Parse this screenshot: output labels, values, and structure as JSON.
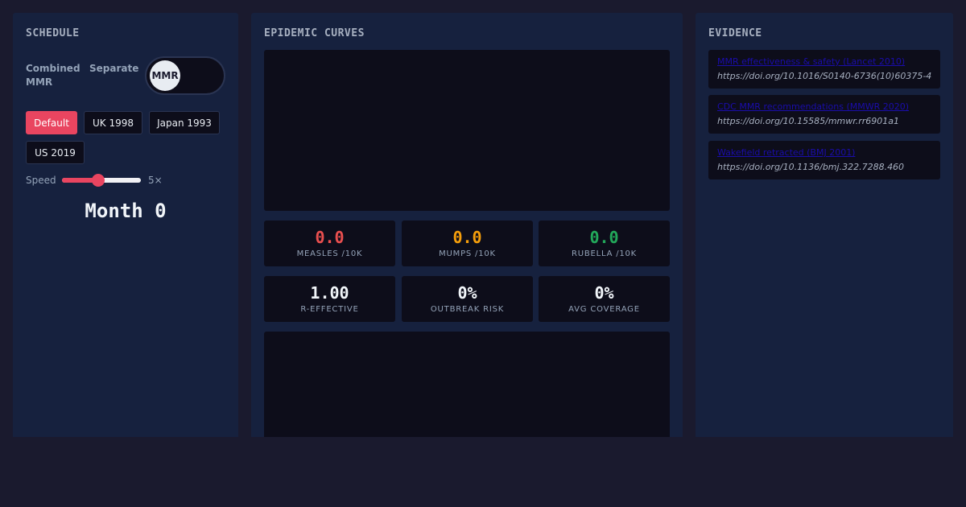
{
  "schedule": {
    "title": "SCHEDULE",
    "combined_label": "Combined MMR",
    "separate_label": "Separate",
    "toggle_label": "MMR",
    "presets": [
      "Default",
      "UK 1998",
      "Japan 1993",
      "US 2019"
    ],
    "active_preset": "Default",
    "speed_label": "Speed",
    "speed_value": "5×",
    "speed_level_fraction": 0.45,
    "month_label": "Month 0"
  },
  "epi": {
    "title": "EPIDEMIC CURVES",
    "stats_row1": [
      {
        "value": "0.0",
        "label": "MEASLES /10K",
        "color": "#e94f4f"
      },
      {
        "value": "0.0",
        "label": "MUMPS /10K",
        "color": "#f59e0b"
      },
      {
        "value": "0.0",
        "label": "RUBELLA /10K",
        "color": "#22a85a"
      }
    ],
    "stats_row2": [
      {
        "value": "1.00",
        "label": "R-EFFECTIVE"
      },
      {
        "value": "0%",
        "label": "OUTBREAK RISK"
      },
      {
        "value": "0%",
        "label": "AVG COVERAGE"
      }
    ]
  },
  "evidence": {
    "title": "EVIDENCE",
    "items": [
      {
        "title": "MMR effectiveness & safety (Lancet 2010)",
        "doi": "https://doi.org/10.1016/S0140-6736(10)60375-4"
      },
      {
        "title": "CDC MMR recommendations (MMWR 2020)",
        "doi": "https://doi.org/10.15585/mmwr.rr6901a1"
      },
      {
        "title": "Wakefield retracted (BMJ 2001)",
        "doi": "https://doi.org/10.1136/bmj.322.7288.460"
      }
    ]
  },
  "colors": {
    "accent": "#e94560",
    "panel": "#16213e",
    "background": "#1a1a2e",
    "card": "#0d0d1a"
  }
}
